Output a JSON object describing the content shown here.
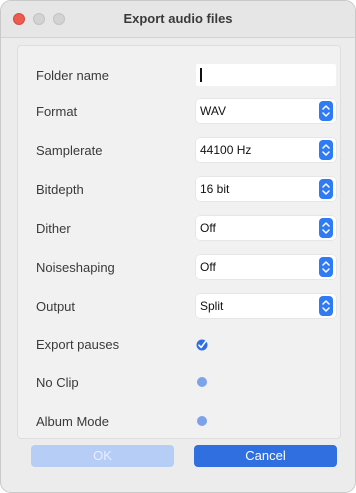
{
  "window": {
    "title": "Export audio files"
  },
  "fields": {
    "folder_name": {
      "label": "Folder name",
      "value": ""
    },
    "format": {
      "label": "Format",
      "value": "WAV"
    },
    "samplerate": {
      "label": "Samplerate",
      "value": "44100 Hz"
    },
    "bitdepth": {
      "label": "Bitdepth",
      "value": "16 bit"
    },
    "dither": {
      "label": "Dither",
      "value": "Off"
    },
    "noiseshaping": {
      "label": "Noiseshaping",
      "value": "Off"
    },
    "output": {
      "label": "Output",
      "value": "Split"
    },
    "export_pauses": {
      "label": "Export pauses",
      "checked": true
    },
    "no_clip": {
      "label": "No Clip",
      "checked": false
    },
    "album_mode": {
      "label": "Album Mode",
      "checked": false
    }
  },
  "buttons": {
    "ok": "OK",
    "cancel": "Cancel"
  },
  "colors": {
    "accent": "#2f6fe0",
    "stepper": "#2f7bf5",
    "close": "#ee5b51"
  }
}
